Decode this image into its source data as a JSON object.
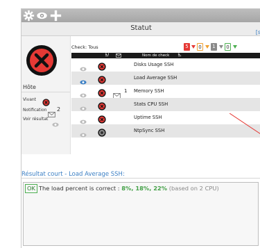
{
  "panel": {
    "title": "Statut",
    "right_link": "[s",
    "right_link2": ""
  },
  "toolbar": {
    "icons": [
      "gear-icon",
      "eye-icon",
      "plus-icon"
    ]
  },
  "host": {
    "label": "Hôte",
    "rows": [
      {
        "label": "Vivant"
      },
      {
        "label": "Notification",
        "count": "2"
      },
      {
        "label": "Voir résultat"
      }
    ]
  },
  "checks": {
    "filter_label": "Check: Tous",
    "badges": [
      "5",
      "0",
      "1",
      "0"
    ],
    "columns": {
      "sort_col": "Ĩ",
      "mail_col": "",
      "name_col": "Nom de check"
    },
    "rows": [
      {
        "name": "Disks Usage SSH",
        "status": "critical",
        "mail_count": ""
      },
      {
        "name": "Load Average SSH",
        "status": "critical",
        "mail_count": "",
        "selected": true
      },
      {
        "name": "Memory SSH",
        "status": "critical",
        "mail_count": "1"
      },
      {
        "name": "Stats CPU SSH",
        "status": "critical",
        "mail_count": ""
      },
      {
        "name": "Uptime SSH",
        "status": "critical",
        "mail_count": ""
      },
      {
        "name": "NtpSync SSH",
        "status": "unknown",
        "mail_count": ""
      }
    ]
  },
  "result": {
    "title": "Résultat court - Load Average SSH:",
    "state": "OK",
    "text": "The load percent is correct :",
    "values": "8%, 18%, 22%",
    "suffix": "(based on 2 CPU)"
  },
  "colors": {
    "critical": "#e53935",
    "ok": "#4caf50",
    "link": "#3b7fc4"
  }
}
